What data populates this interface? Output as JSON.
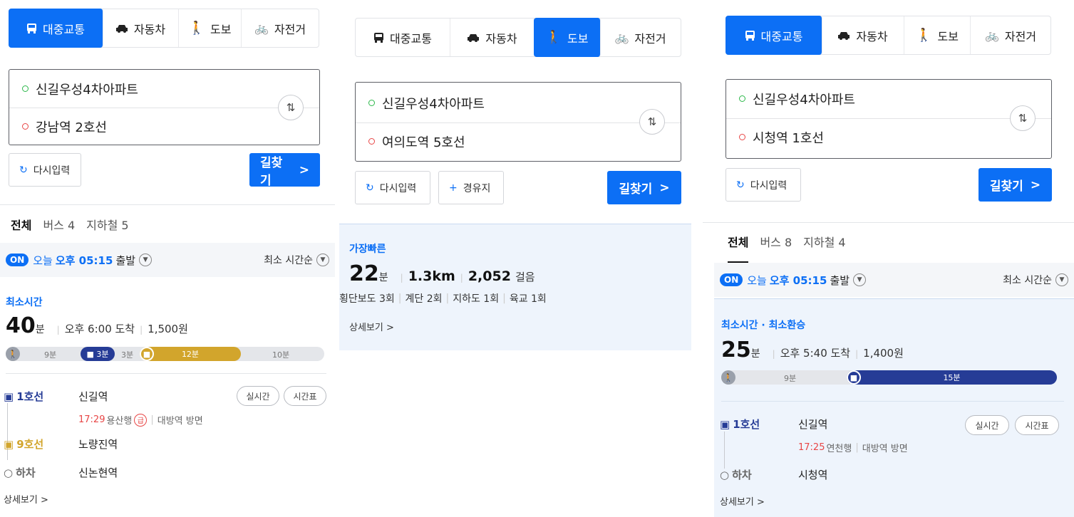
{
  "colors": {
    "accent": "#0c6ff5",
    "line1": "#263c96",
    "line9": "#d2a52c",
    "red": "#e84646",
    "walk": "#9aa0aa"
  },
  "modes": {
    "transit": "대중교통",
    "car": "자동차",
    "walk": "도보",
    "bike": "자전거"
  },
  "common": {
    "reset_label": "다시입력",
    "waypoint_label": "경유지",
    "search_label": "길찾기",
    "search_arrow": ">",
    "detail_label": "상세보기 >",
    "origin": "신길우성4차아파트",
    "realtime_label": "실시간",
    "timetable_label": "시간표",
    "on_badge": "ON",
    "today": "오늘",
    "depart_time": "오후 05:15",
    "depart_suffix": "출발",
    "sort_label": "최소 시간순"
  },
  "panel1": {
    "destination": "강남역 2호선",
    "tabs": [
      "전체",
      "버스 4",
      "지하철 5"
    ],
    "route_tag": "최소시간",
    "duration_value": "40",
    "duration_unit": "분",
    "arrival": "오후 6:00 도착",
    "fare": "1,500원",
    "timeline": {
      "walk1": "9분",
      "bus_badge": "3분",
      "walk2": "3분",
      "sub9": "12분",
      "walk3": "10분"
    },
    "steps": [
      {
        "line": "1호선",
        "station": "신길역"
      },
      {
        "line": "9호선",
        "station": "노량진역"
      },
      {
        "line": "하차",
        "station": "신논현역"
      }
    ],
    "sub_time": "17:29",
    "sub_dest": "용산행",
    "express": "급",
    "sub_dir": "대방역 방면"
  },
  "panel2": {
    "destination": "여의도역 5호선",
    "route_tag": "가장빠른",
    "duration_value": "22",
    "duration_unit": "분",
    "distance": "1.3km",
    "steps_count": "2,052",
    "steps_unit": "걸음",
    "crossings": [
      "횡단보도 3회",
      "계단 2회",
      "지하도 1회",
      "육교 1회"
    ]
  },
  "panel3": {
    "destination": "시청역 1호선",
    "tabs": [
      "전체",
      "버스 8",
      "지하철 4"
    ],
    "route_tag": "최소시간 · 최소환승",
    "duration_value": "25",
    "duration_unit": "분",
    "arrival": "오후 5:40 도착",
    "fare": "1,400원",
    "timeline": {
      "walk": "9분",
      "sub1": "15분"
    },
    "steps": [
      {
        "line": "1호선",
        "station": "신길역"
      },
      {
        "line": "하차",
        "station": "시청역"
      }
    ],
    "sub_time": "17:25",
    "sub_dest": "연천행",
    "sub_dir": "대방역 방면"
  }
}
